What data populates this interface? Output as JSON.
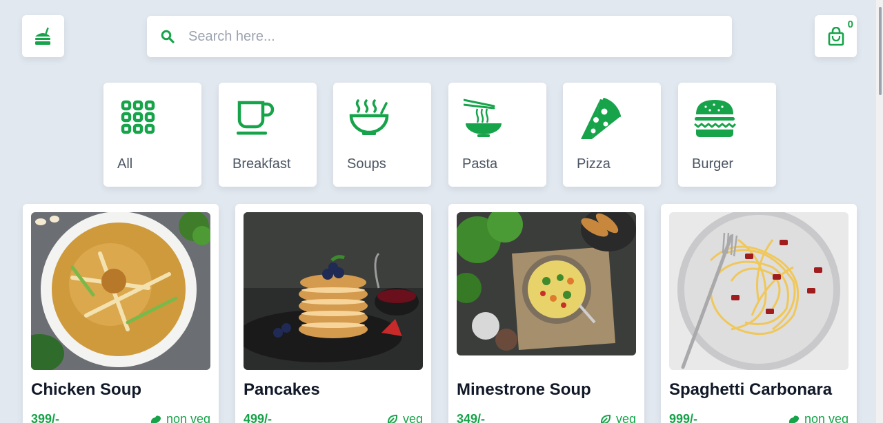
{
  "header": {
    "search_placeholder": "Search here...",
    "cart_count": "0"
  },
  "categories": [
    {
      "label": "All",
      "icon": "grid-icon"
    },
    {
      "label": "Breakfast",
      "icon": "coffee-cup-icon"
    },
    {
      "label": "Soups",
      "icon": "soup-bowl-icon"
    },
    {
      "label": "Pasta",
      "icon": "noodle-bowl-icon"
    },
    {
      "label": "Pizza",
      "icon": "pizza-slice-icon"
    },
    {
      "label": "Burger",
      "icon": "burger-icon"
    }
  ],
  "foods": [
    {
      "name": "Chicken Soup",
      "price": "399/-",
      "type": "non veg"
    },
    {
      "name": "Pancakes",
      "price": "499/-",
      "type": "veg"
    },
    {
      "name": "Minestrone Soup",
      "price": "349/-",
      "type": "veg"
    },
    {
      "name": "Spaghetti Carbonara",
      "price": "999/-",
      "type": "non veg"
    }
  ],
  "colors": {
    "accent": "#16a34a",
    "background": "#e2e8f0"
  }
}
